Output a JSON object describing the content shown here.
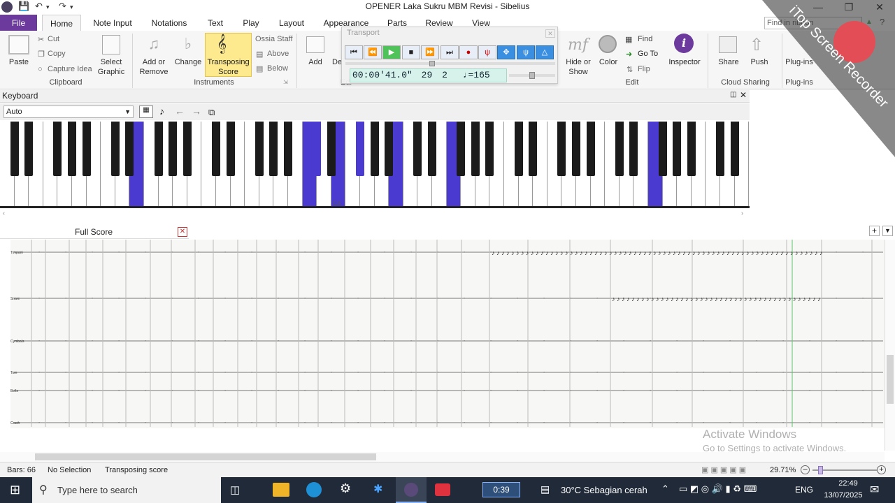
{
  "window": {
    "title": "OPENER Laka Sukru MBM Revisi - Sibelius"
  },
  "tabs": {
    "file": "File",
    "items": [
      "Home",
      "Note Input",
      "Notations",
      "Text",
      "Play",
      "Layout",
      "Appearance",
      "Parts",
      "Review",
      "View"
    ],
    "active": "Home"
  },
  "search": {
    "placeholder": "Find in ribbon"
  },
  "ribbon": {
    "clipboard": {
      "paste": "Paste",
      "cut": "Cut",
      "copy": "Copy",
      "capture_idea": "Capture Idea",
      "select_graphic_1": "Select",
      "select_graphic_2": "Graphic",
      "label": "Clipboard"
    },
    "instruments": {
      "add_remove_1": "Add or",
      "add_remove_2": "Remove",
      "change": "Change",
      "transposing_1": "Transposing",
      "transposing_2": "Score",
      "ossia_staff": "Ossia Staff",
      "above": "Above",
      "below": "Below",
      "label": "Instruments"
    },
    "bars": {
      "add": "Add",
      "delete": "De"
    },
    "edit": {
      "hide_show_1": "Hide or",
      "hide_show_2": "Show",
      "color": "Color",
      "find": "Find",
      "goto": "Go To",
      "flip": "Flip",
      "inspector": "Inspector",
      "label": "Edit"
    },
    "cloud": {
      "share": "Share",
      "push": "Push",
      "label": "Cloud Sharing"
    },
    "plugins": {
      "plugins": "Plug-ins",
      "label": "Plug-ins"
    },
    "partial_label_edit": "Edi"
  },
  "transport": {
    "title": "Transport",
    "time": "00:00'41.0\"",
    "bar": "29",
    "beat": "2",
    "tempo": "♩=165"
  },
  "keyboard": {
    "title": "Keyboard",
    "mode": "Auto",
    "c4_label": "C4"
  },
  "score": {
    "tab_label": "Full Score",
    "instruments": [
      "Timpani",
      "Snare",
      "Cymbals",
      "Tom",
      "Bells",
      "Crash"
    ]
  },
  "activation": {
    "line1": "Activate Windows",
    "line2": "Go to Settings to activate Windows."
  },
  "status": {
    "bars": "Bars: 66",
    "selection": "No Selection",
    "mode": "Transposing score",
    "zoom": "29.71%"
  },
  "taskbar": {
    "search": "Type here to search",
    "timer": "0:39",
    "weather": "30°C  Sebagian cerah",
    "lang": "ENG",
    "time": "22:49",
    "date": "13/07/2025"
  },
  "watermark": {
    "text": "iTop Screen Recorder"
  },
  "colors": {
    "accent": "#6c3a9c",
    "highlight": "#fde98e",
    "key_active": "#4a3ad0"
  }
}
